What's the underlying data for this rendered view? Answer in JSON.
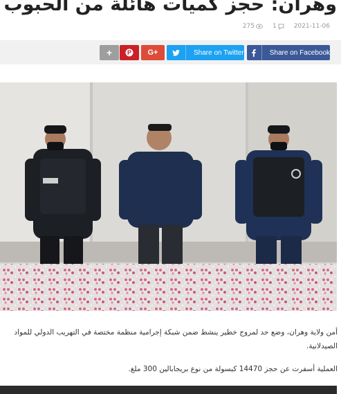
{
  "article": {
    "title": "وهران: حجز كميات هائلة من الحبوب المهلوسة",
    "meta": {
      "date": "2021-11-06",
      "comments": "1",
      "views": "275"
    },
    "share": {
      "more_label": "+",
      "pinterest_label": "P",
      "gplus_label": "G+",
      "twitter_label": "Share on Twitter",
      "facebook_label": "Share on Facebook"
    },
    "image_alt": "",
    "paragraphs": [
      "أمن ولاية وهران، وضع حد  لمروج خطير ينشط ضمن شبكة إجرامية منظمة مختصة في التهريب الدولي للمواد الصيدلانية.",
      "العملية أسفرت عن حجز 14470 كبسولة من نوع بريجابالين 300 ملغ."
    ]
  },
  "colors": {
    "twitter": "#1da1f2",
    "facebook": "#3b5998",
    "pinterest": "#cb2027",
    "gplus": "#dd4b39",
    "more": "#9e9e9e"
  },
  "icons": [
    "calendar-icon",
    "comment-icon",
    "eye-icon",
    "plus-icon",
    "pinterest-icon",
    "google-plus-icon",
    "twitter-icon",
    "facebook-icon"
  ]
}
